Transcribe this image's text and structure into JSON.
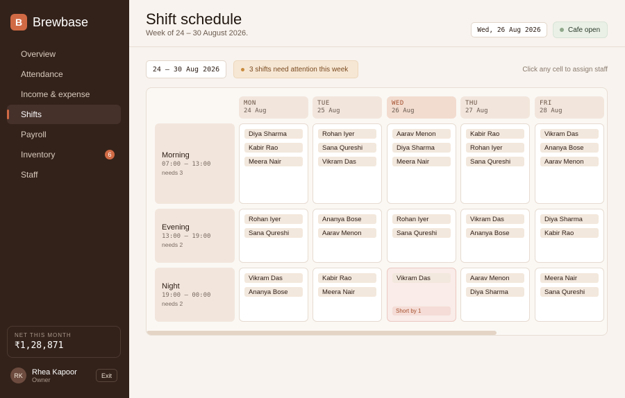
{
  "brand": {
    "initial": "B",
    "name": "Brewbase"
  },
  "nav": [
    {
      "label": "Overview"
    },
    {
      "label": "Attendance"
    },
    {
      "label": "Income & expense"
    },
    {
      "label": "Shifts",
      "active": true
    },
    {
      "label": "Payroll"
    },
    {
      "label": "Inventory",
      "badge": "6"
    },
    {
      "label": "Staff"
    }
  ],
  "net": {
    "label": "NET THIS MONTH",
    "value": "₹1,28,871"
  },
  "user": {
    "initials": "RK",
    "name": "Rhea Kapoor",
    "role": "Owner",
    "exit_label": "Exit"
  },
  "header": {
    "title": "Shift schedule",
    "subtitle": "Week of 24 – 30 August 2026.",
    "date": "Wed, 26 Aug 2026",
    "status": "Cafe open"
  },
  "toolbar": {
    "week": "24 – 30 Aug 2026",
    "attention": "3 shifts need attention this week",
    "hint": "Click any cell to assign staff"
  },
  "days": [
    {
      "name": "MON",
      "date": "24 Aug"
    },
    {
      "name": "TUE",
      "date": "25 Aug"
    },
    {
      "name": "WED",
      "date": "26 Aug",
      "today": true
    },
    {
      "name": "THU",
      "date": "27 Aug"
    },
    {
      "name": "FRI",
      "date": "28 Aug"
    }
  ],
  "shifts": [
    {
      "name": "Morning",
      "time": "07:00 – 13:00",
      "needs": "needs 3",
      "cells": [
        {
          "staff": [
            "Diya Sharma",
            "Kabir Rao",
            "Meera Nair"
          ]
        },
        {
          "staff": [
            "Rohan Iyer",
            "Sana Qureshi",
            "Vikram Das"
          ]
        },
        {
          "staff": [
            "Aarav Menon",
            "Diya Sharma",
            "Meera Nair"
          ]
        },
        {
          "staff": [
            "Kabir Rao",
            "Rohan Iyer",
            "Sana Qureshi"
          ]
        },
        {
          "staff": [
            "Vikram Das",
            "Ananya Bose",
            "Aarav Menon"
          ]
        }
      ]
    },
    {
      "name": "Evening",
      "time": "13:00 – 19:00",
      "needs": "needs 2",
      "cells": [
        {
          "staff": [
            "Rohan Iyer",
            "Sana Qureshi"
          ]
        },
        {
          "staff": [
            "Ananya Bose",
            "Aarav Menon"
          ]
        },
        {
          "staff": [
            "Rohan Iyer",
            "Sana Qureshi"
          ]
        },
        {
          "staff": [
            "Vikram Das",
            "Ananya Bose"
          ]
        },
        {
          "staff": [
            "Diya Sharma",
            "Kabir Rao"
          ]
        }
      ]
    },
    {
      "name": "Night",
      "time": "19:00 – 00:00",
      "needs": "needs 2",
      "cells": [
        {
          "staff": [
            "Vikram Das",
            "Ananya Bose"
          ]
        },
        {
          "staff": [
            "Kabir Rao",
            "Meera Nair"
          ]
        },
        {
          "staff": [
            "Vikram Das"
          ],
          "short": "Short by 1"
        },
        {
          "staff": [
            "Aarav Menon",
            "Diya Sharma"
          ]
        },
        {
          "staff": [
            "Meera Nair",
            "Sana Qureshi"
          ]
        }
      ]
    }
  ]
}
